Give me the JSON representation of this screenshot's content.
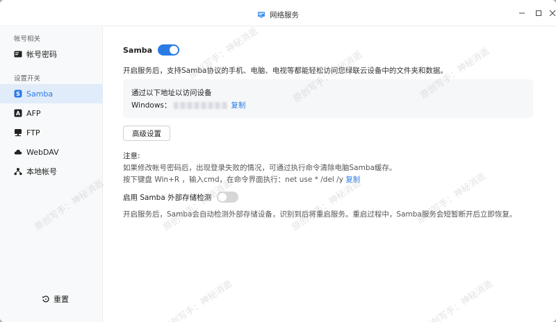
{
  "window": {
    "title": "网络服务"
  },
  "sidebar": {
    "groups": [
      {
        "label": "帐号相关",
        "items": [
          {
            "label": "帐号密码",
            "icon": "id-card-icon"
          }
        ]
      },
      {
        "label": "设置开关",
        "items": [
          {
            "label": "Samba",
            "icon": "samba-icon",
            "active": true
          },
          {
            "label": "AFP",
            "icon": "afp-icon"
          },
          {
            "label": "FTP",
            "icon": "ftp-icon"
          },
          {
            "label": "WebDAV",
            "icon": "cloud-icon"
          },
          {
            "label": "本地帐号",
            "icon": "local-account-icon"
          }
        ]
      }
    ],
    "reset_label": "重置"
  },
  "main": {
    "samba_label": "Samba",
    "samba_enabled": true,
    "description": "开启服务后，支持Samba协议的手机、电脑、电视等都能轻松访问您绿联云设备中的文件夹和数据。",
    "access_box": {
      "title": "通过以下地址以访问设备",
      "address_prefix": "Windows：",
      "copy_label": "复制"
    },
    "advanced_button": "高级设置",
    "note": {
      "title": "注意:",
      "line1": "如果修改帐号密码后，出现登录失败的情况，可通过执行命令清除电脑Samba缓存。",
      "line2": "按下键盘 Win+R ，输入cmd，在命令界面执行：net use * /del /y",
      "copy_label": "复制"
    },
    "external_storage": {
      "label": "启用 Samba 外部存储检测",
      "enabled": false,
      "description": "开启服务后，Samba会自动检测外部存储设备，识别到后将重启服务。重启过程中，Samba服务会短暂断开后立即恢复。"
    }
  },
  "watermark": {
    "text": "原创写手：神秘消逝"
  },
  "colors": {
    "accent": "#2a7be4",
    "active_bg": "#e1ecfb",
    "sidebar_bg": "#f8f9fa"
  }
}
